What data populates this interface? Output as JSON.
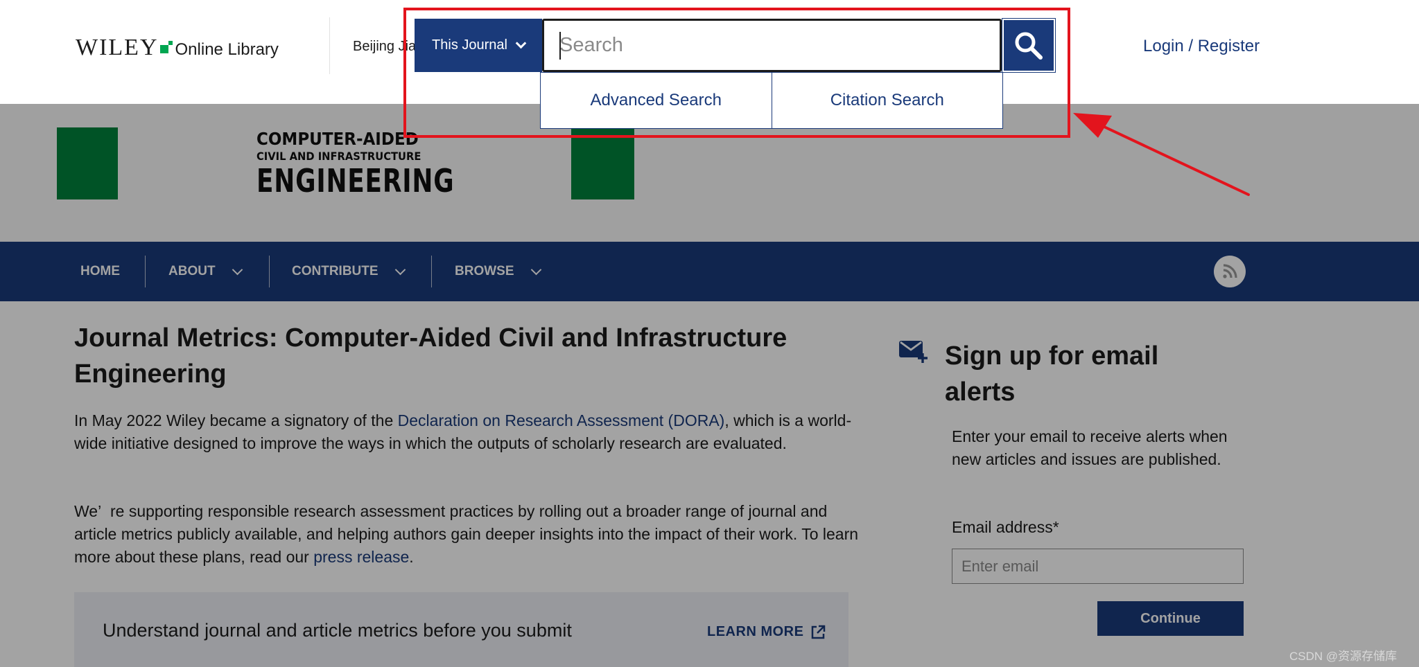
{
  "header": {
    "logo_wordmark": "WILEY",
    "logo_subtitle": "Online Library",
    "institution": "Beijing Jia",
    "login_link": "Login / Register"
  },
  "search": {
    "scope_label": "This Journal",
    "placeholder": "Search",
    "options": [
      "Advanced Search",
      "Citation Search"
    ]
  },
  "journal_banner": {
    "title_line1": "COMPUTER-AIDED",
    "title_line2": "CIVIL AND INFRASTRUCTURE",
    "title_line3": "ENGINEERING",
    "accent_color": "#00823c"
  },
  "nav": {
    "items": [
      {
        "label": "HOME",
        "has_dropdown": false
      },
      {
        "label": "ABOUT",
        "has_dropdown": true
      },
      {
        "label": "CONTRIBUTE",
        "has_dropdown": true
      },
      {
        "label": "BROWSE",
        "has_dropdown": true
      }
    ],
    "background": "#1a3a7a",
    "rss_icon": "rss-icon"
  },
  "main": {
    "title": "Journal Metrics: Computer-Aided Civil and Infrastructure Engineering",
    "para1_before": "In May 2022 Wiley became a signatory of the ",
    "para1_link": "Declaration on Research Assessment (DORA)",
    "para1_after": ", which is a world-wide initiative designed to improve the ways in which the outputs of scholarly research are evaluated.",
    "para2_before": "We’  re supporting responsible research assessment practices by rolling out a broader range of journal and article metrics publicly available, and helping authors gain deeper insights into the impact of their work. To learn more about these plans, read our ",
    "para2_link": "press release",
    "para2_after": ".",
    "metrics_box_text": "Understand journal and article metrics before you submit",
    "learn_more": "LEARN MORE"
  },
  "sidebar": {
    "title": "Sign up for email alerts",
    "description": "Enter your email to receive alerts when new articles and issues are published.",
    "email_label": "Email address*",
    "email_placeholder": "Enter email",
    "continue_label": "Continue"
  },
  "annotation": {
    "highlight_color": "#e3141d"
  },
  "watermark": "CSDN @资源存储库"
}
